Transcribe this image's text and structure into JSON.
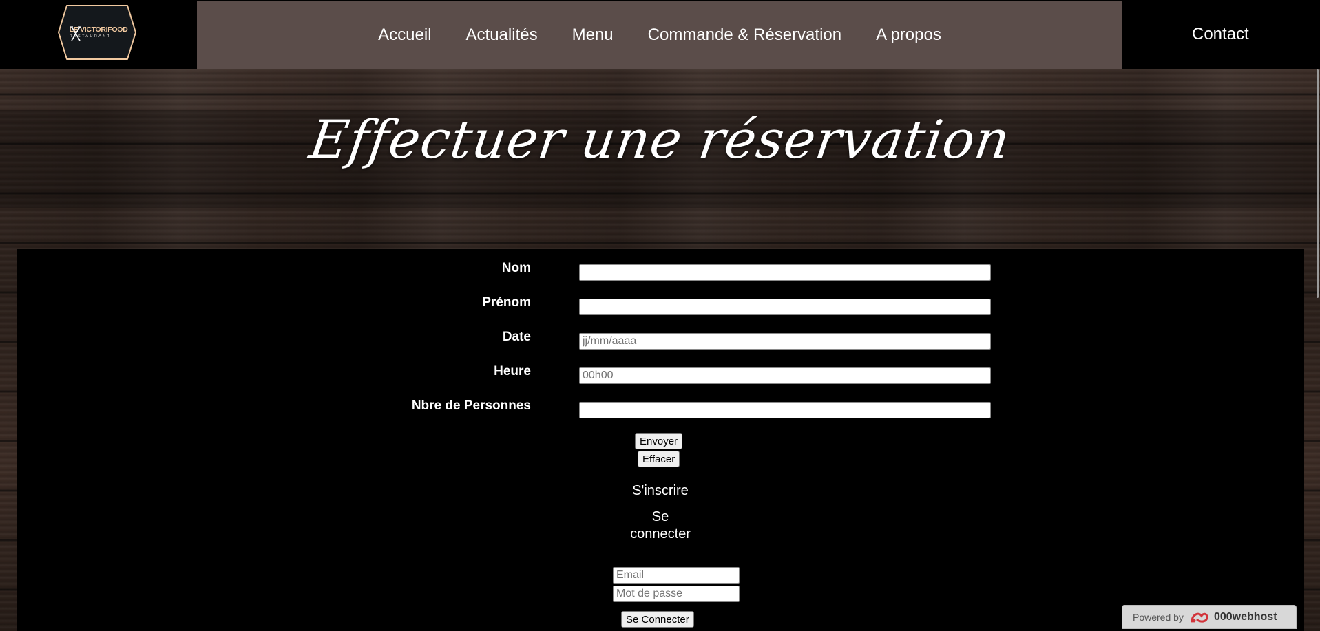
{
  "logo": {
    "name": "LE VICTORIFOOD",
    "sub": "RESTAURANT"
  },
  "nav": {
    "items": [
      {
        "label": "Accueil"
      },
      {
        "label": "Actualités"
      },
      {
        "label": "Menu"
      },
      {
        "label": "Commande & Réservation"
      },
      {
        "label": "A propos"
      }
    ],
    "contact": "Contact"
  },
  "page": {
    "title": "Effectuer une réservation"
  },
  "form": {
    "fields": [
      {
        "label": "Nom",
        "placeholder": ""
      },
      {
        "label": "Prénom",
        "placeholder": ""
      },
      {
        "label": "Date",
        "placeholder": "jj/mm/aaaa"
      },
      {
        "label": "Heure",
        "placeholder": "00h00"
      },
      {
        "label": "Nbre de Personnes",
        "placeholder": ""
      }
    ],
    "submit_label": "Envoyer",
    "reset_label": "Effacer"
  },
  "auth": {
    "register_link": "S'inscrire",
    "login_line1": "Se",
    "login_line2": "connecter",
    "email_placeholder": "Email",
    "password_placeholder": "Mot de passe",
    "login_button": "Se Connecter"
  },
  "badge": {
    "powered_by": "Powered by",
    "brand": "000webhost"
  },
  "colors": {
    "nav_bg": "#5b4d4a",
    "logo_gold": "#f1c9a0",
    "badge_bg": "#d8d8d8"
  }
}
